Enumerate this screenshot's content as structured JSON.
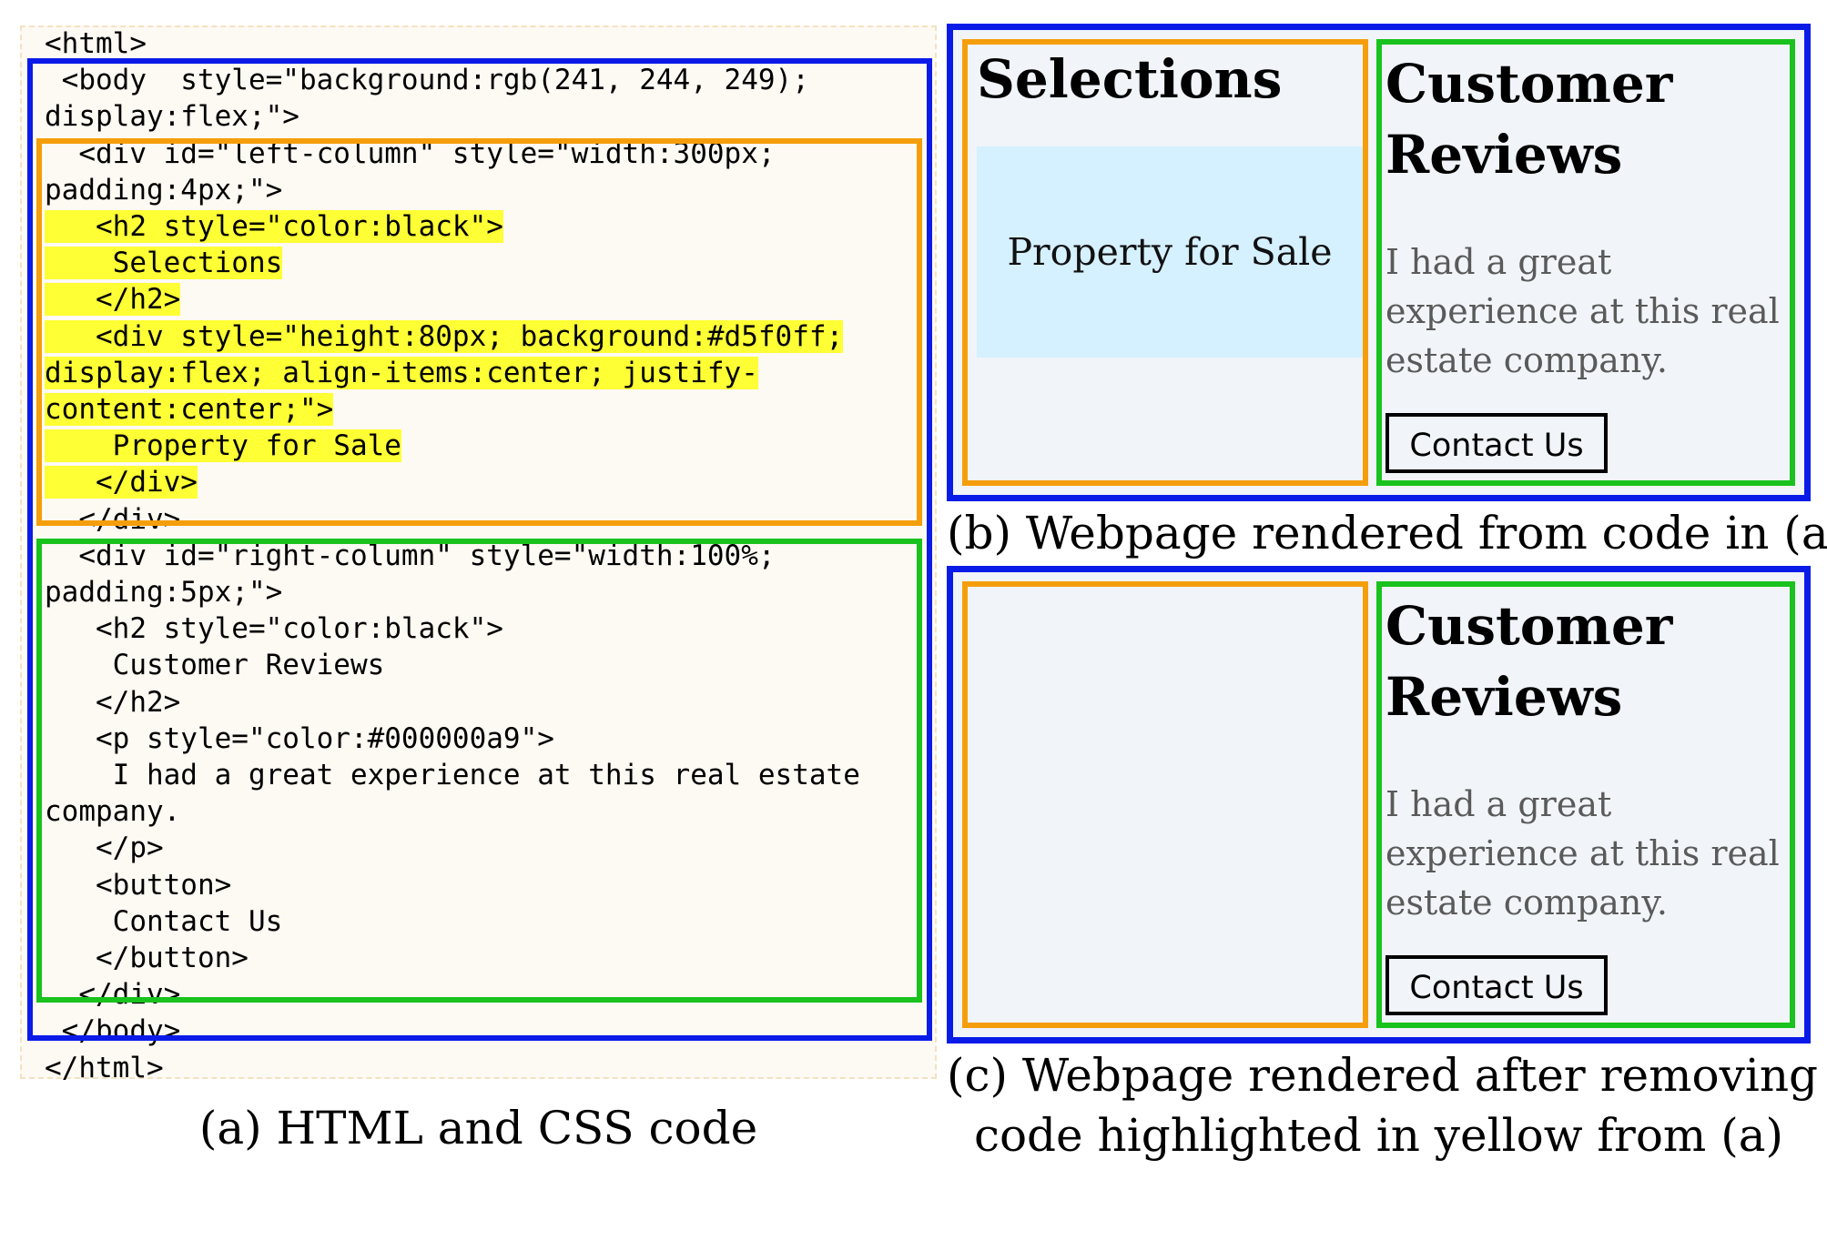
{
  "code_panel": {
    "lines": [
      {
        "text": "<html>",
        "highlight": false
      },
      {
        "text": " <body  style=\"background:rgb(241, 244, 249);",
        "highlight": false
      },
      {
        "text": "display:flex;\">",
        "highlight": false
      },
      {
        "text": "  <div id=\"left-column\" style=\"width:300px;",
        "highlight": false
      },
      {
        "text": "padding:4px;\">",
        "highlight": false
      },
      {
        "text": "   <h2 style=\"color:black\">",
        "highlight": true
      },
      {
        "text": "    Selections",
        "highlight": true
      },
      {
        "text": "   </h2>",
        "highlight": true
      },
      {
        "text": "   <div style=\"height:80px; background:#d5f0ff;",
        "highlight": true
      },
      {
        "text": "display:flex; align-items:center; justify-",
        "highlight": true
      },
      {
        "text": "content:center;\">",
        "highlight": true
      },
      {
        "text": "    Property for Sale",
        "highlight": true
      },
      {
        "text": "   </div>",
        "highlight": true
      },
      {
        "text": "  </div>",
        "highlight": false
      },
      {
        "text": "  <div id=\"right-column\" style=\"width:100%;",
        "highlight": false
      },
      {
        "text": "padding:5px;\">",
        "highlight": false
      },
      {
        "text": "   <h2 style=\"color:black\">",
        "highlight": false
      },
      {
        "text": "    Customer Reviews",
        "highlight": false
      },
      {
        "text": "   </h2>",
        "highlight": false
      },
      {
        "text": "   <p style=\"color:#000000a9\">",
        "highlight": false
      },
      {
        "text": "    I had a great experience at this real estate",
        "highlight": false
      },
      {
        "text": "company.",
        "highlight": false
      },
      {
        "text": "   </p>",
        "highlight": false
      },
      {
        "text": "   <button>",
        "highlight": false
      },
      {
        "text": "    Contact Us",
        "highlight": false
      },
      {
        "text": "   </button>",
        "highlight": false
      },
      {
        "text": "  </div>",
        "highlight": false
      },
      {
        "text": " </body>",
        "highlight": false
      },
      {
        "text": "</html>",
        "highlight": false
      }
    ]
  },
  "render_b": {
    "selections_title": "Selections",
    "property_label": "Property for Sale",
    "reviews_title": "Customer Reviews",
    "review_text": "I had a great experience at this real estate company.",
    "contact_button": "Contact Us"
  },
  "render_c": {
    "reviews_title": "Customer Reviews",
    "review_text": "I had a great experience at this real estate company.",
    "contact_button": "Contact Us"
  },
  "captions": {
    "a": "(a) HTML and CSS code",
    "b": "(b) Webpage rendered from code in (a)",
    "c_line1": "(c) Webpage rendered after removing",
    "c_line2": "code highlighted in yellow from (a)"
  },
  "colors": {
    "body_box": "#0a1be8",
    "left_column_box": "#f59e0b",
    "right_column_box": "#19c21d",
    "highlight": "#ffff35",
    "page_background": "#f1f4f9",
    "property_box": "#d5f0ff"
  }
}
